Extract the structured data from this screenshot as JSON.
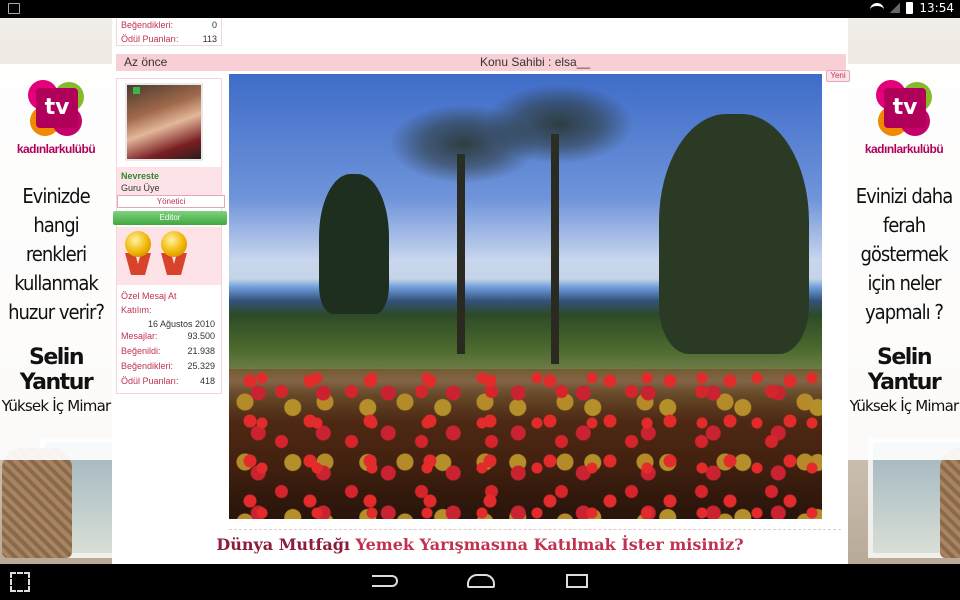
{
  "status_bar": {
    "time": "13:54",
    "icons": [
      "image-icon",
      "wifi-icon",
      "signal-icon",
      "battery-icon"
    ]
  },
  "ads": {
    "left": {
      "brand": "kadınlarkulübü",
      "logo_text": "tv",
      "question": "Evinizde hangi renkleri kullanmak huzur verir?",
      "name": "Selin Yantur",
      "role": "Yüksek İç Mimar"
    },
    "right": {
      "brand": "kadınlarkulübü",
      "logo_text": "tv",
      "question": "Evinizi daha ferah göstermek için neler yapmalı ?",
      "name": "Selin Yantur",
      "role": "Yüksek İç Mimar"
    }
  },
  "top_stats": {
    "rows": [
      {
        "label": "Beğendikleri:",
        "value": "0"
      },
      {
        "label": "Ödül Puanları:",
        "value": "113"
      }
    ]
  },
  "post": {
    "time": "Az önce",
    "owner": "Konu Sahibi : elsa__",
    "new_badge": "Yeni"
  },
  "user": {
    "name": "Nevreste",
    "title": "Guru Üye",
    "role_admin": "Yönetici",
    "role_editor": "Editor",
    "pm_link": "Özel Mesaj At",
    "join_label": "Katılım:",
    "join_date": "16 Ağustos 2010",
    "stats": [
      {
        "label": "Mesajlar:",
        "value": "93.500"
      },
      {
        "label": "Beğenildi:",
        "value": "21.938"
      },
      {
        "label": "Beğendikleri:",
        "value": "25.329"
      },
      {
        "label": "Ödül Puanları:",
        "value": "418"
      }
    ]
  },
  "headline": {
    "part1": "Dünya Mutfağı",
    "part2": "Yemek Yarışmasına Katılmak İster misiniz?"
  },
  "colors": {
    "accent_pink": "#f9cfd6",
    "label_red": "#c0334f",
    "headline_dark": "#8a1d3a"
  }
}
